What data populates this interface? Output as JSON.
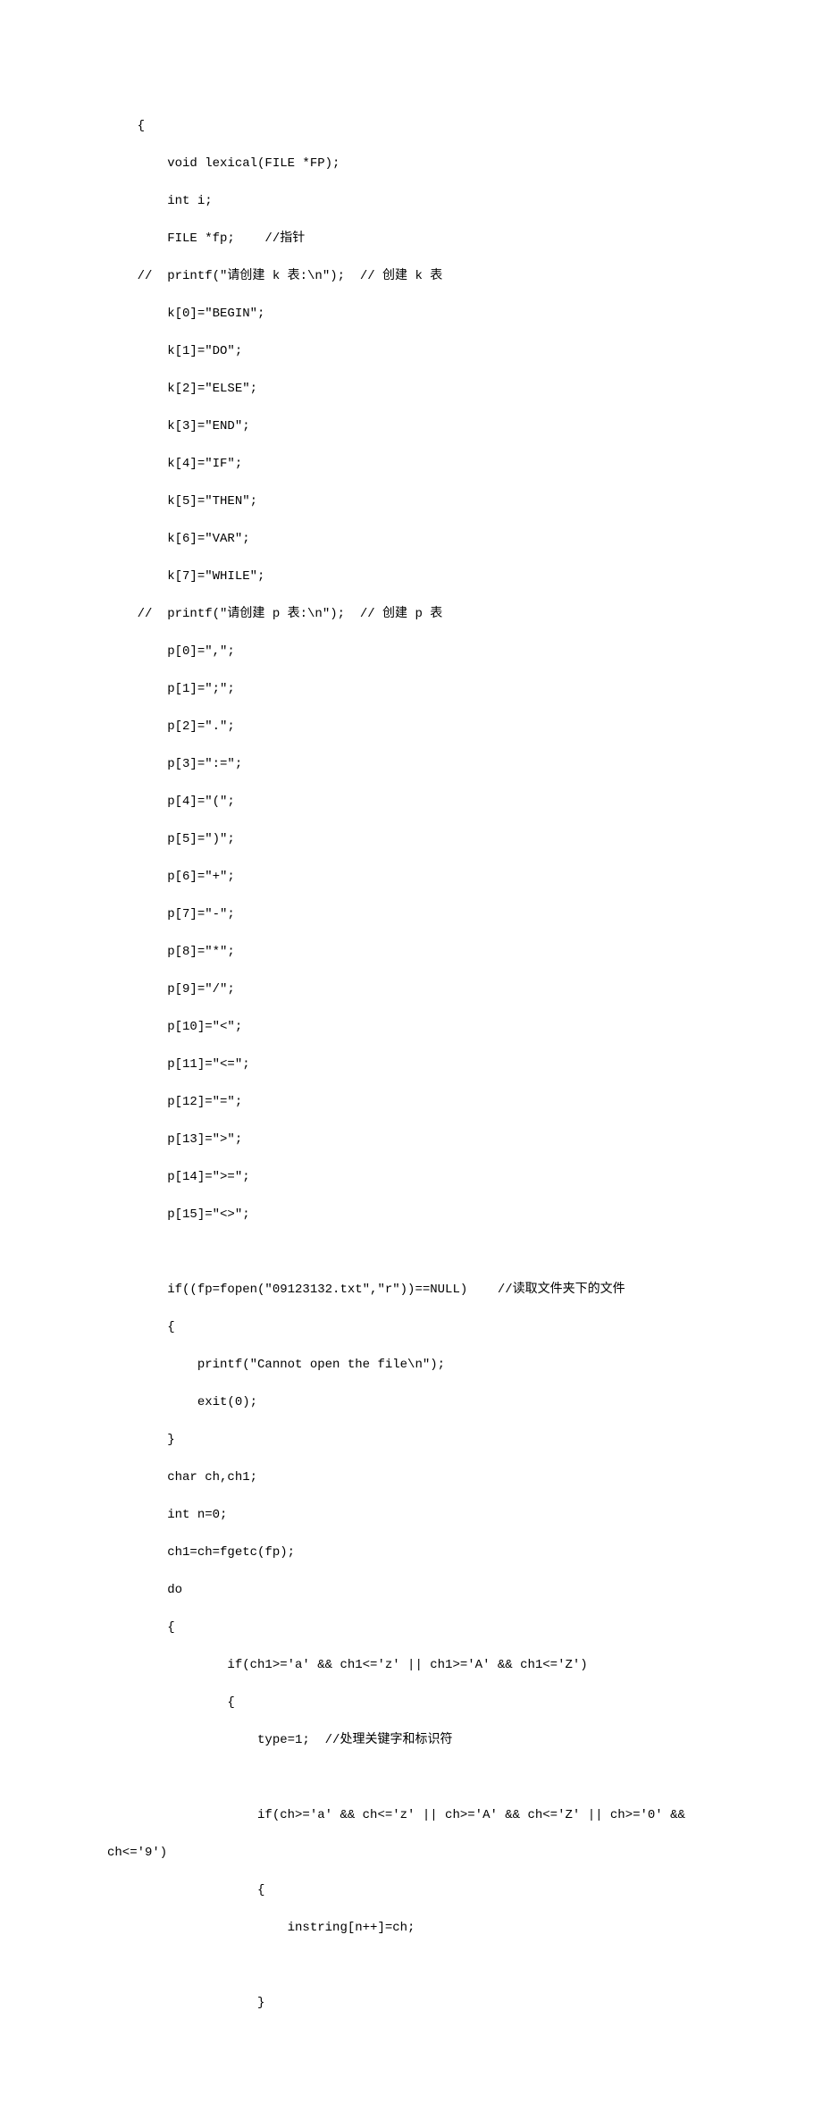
{
  "code": {
    "lines": [
      "    {",
      "        void lexical(FILE *FP);",
      "        int i;",
      "        FILE *fp;    //指针",
      "    //  printf(\"请创建 k 表:\\n\");  // 创建 k 表",
      "        k[0]=\"BEGIN\";",
      "        k[1]=\"DO\";",
      "        k[2]=\"ELSE\";",
      "        k[3]=\"END\";",
      "        k[4]=\"IF\";",
      "        k[5]=\"THEN\";",
      "        k[6]=\"VAR\";",
      "        k[7]=\"WHILE\";",
      "    //  printf(\"请创建 p 表:\\n\");  // 创建 p 表",
      "        p[0]=\",\";",
      "        p[1]=\";\";",
      "        p[2]=\".\";",
      "        p[3]=\":=\";",
      "        p[4]=\"(\";",
      "        p[5]=\")\";",
      "        p[6]=\"+\";",
      "        p[7]=\"-\";",
      "        p[8]=\"*\";",
      "        p[9]=\"/\";",
      "        p[10]=\"<\";",
      "        p[11]=\"<=\";",
      "        p[12]=\"=\";",
      "        p[13]=\">\";",
      "        p[14]=\">=\";",
      "        p[15]=\"<>\";",
      "",
      "        if((fp=fopen(\"09123132.txt\",\"r\"))==NULL)    //读取文件夹下的文件",
      "        {",
      "            printf(\"Cannot open the file\\n\");",
      "            exit(0);",
      "        }",
      "        char ch,ch1;",
      "        int n=0;",
      "        ch1=ch=fgetc(fp);",
      "        do",
      "        {",
      "                if(ch1>='a' && ch1<='z' || ch1>='A' && ch1<='Z')",
      "                {",
      "                    type=1;  //处理关键字和标识符",
      "",
      "                    if(ch>='a' && ch<='z' || ch>='A' && ch<='Z' || ch>='0' &&",
      "ch<='9')",
      "                    {",
      "                        instring[n++]=ch;",
      "",
      "                    }"
    ]
  }
}
